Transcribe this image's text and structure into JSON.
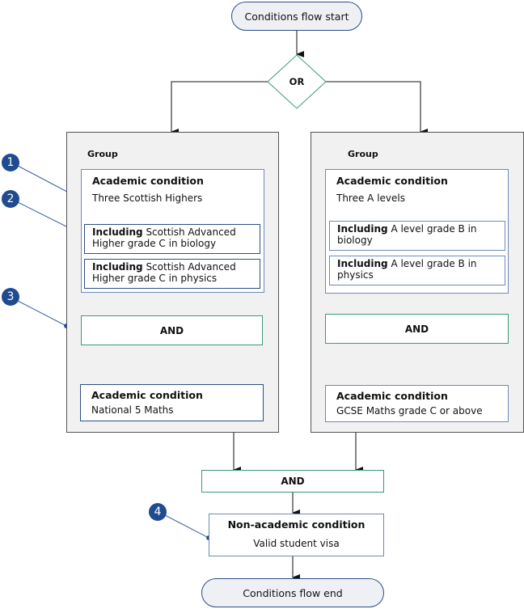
{
  "start": {
    "label": "Conditions flow start"
  },
  "end": {
    "label": "Conditions flow end"
  },
  "or_gate": {
    "label": "OR"
  },
  "left_group": {
    "label": "Group",
    "condition": {
      "title": "Academic condition",
      "text": "Three Scottish Highers",
      "includes": [
        {
          "keyword": "Including",
          "text": " Scottish Advanced Higher grade C in biology"
        },
        {
          "keyword": "Including",
          "text": " Scottish Advanced Higher grade C in physics"
        }
      ]
    },
    "and_label": "AND",
    "second_condition": {
      "title": "Academic condition",
      "text": "National 5 Maths"
    }
  },
  "right_group": {
    "label": "Group",
    "condition": {
      "title": "Academic condition",
      "text": "Three A levels",
      "includes": [
        {
          "keyword": "Including",
          "text": " A level grade B in biology"
        },
        {
          "keyword": "Including",
          "text": " A level grade B in physics"
        }
      ]
    },
    "and_label": "AND",
    "second_condition": {
      "title": "Academic condition",
      "text": "GCSE Maths grade C or above"
    }
  },
  "join_and": {
    "label": "AND"
  },
  "non_academic": {
    "title": "Non-academic condition",
    "text": "Valid student visa"
  },
  "callouts": [
    "1",
    "2",
    "3",
    "4"
  ],
  "colors": {
    "callout": "#1f4b8f",
    "condition_border": "#2c4e86",
    "logic_border": "#3c9a72",
    "group_fill": "#f1f1f1",
    "terminal_fill": "#eef0f4"
  }
}
